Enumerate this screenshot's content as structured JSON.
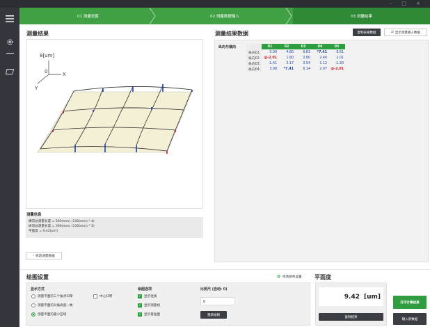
{
  "window": {
    "controls": "– □ ×"
  },
  "steps": [
    {
      "label": "01 测量设置"
    },
    {
      "label": "02 测量数据输入"
    },
    {
      "label": "03 测量结果"
    }
  ],
  "result_panel": {
    "title": "测量结果",
    "axis": {
      "z_label": "8[um]",
      "origin": "0",
      "x": "X",
      "y": "Y"
    },
    "info_title": "测量信息",
    "info_lines": [
      "横向总测量长度 = 560(mm) (140(mm) * 4)",
      "纵向总测量长度 = 390(mm) (130(mm) * 3)",
      "平面度 = 9.42[um]"
    ],
    "edit_button": "修改测量数据"
  },
  "data_panel": {
    "title": "测量结果数据",
    "copy_table_button": "复制表格数据",
    "toggle_button": "显示测量输入数据",
    "table_label": "纵向与横向",
    "columns": [
      "01",
      "02",
      "03",
      "04",
      "05"
    ],
    "rows": [
      {
        "label": "纵向01",
        "values": [
          "0.00",
          "4.80",
          "6.81",
          "*7.41",
          "6.61"
        ]
      },
      {
        "label": "纵向02",
        "values": [
          "@-2.01",
          "1.80",
          "2.80",
          "2.40",
          "2.01"
        ]
      },
      {
        "label": "纵向03",
        "values": [
          "-1.41",
          "3.17",
          "3.54",
          "1.12",
          "-1.30"
        ]
      },
      {
        "label": "纵向04",
        "values": [
          "3.08",
          "*7.41",
          "6.14",
          "2.07",
          "@-2.01"
        ]
      }
    ]
  },
  "draw_settings": {
    "title": "绘图设置",
    "color_link": "修改颜色设置",
    "display_mode_title": "显示方式",
    "display_modes": [
      {
        "label": "测量平面的三个角点归零",
        "selected": false
      },
      {
        "label": "测量平面的对角高度一致",
        "selected": false
      },
      {
        "label": "测量平面的最小区域",
        "selected": true
      }
    ],
    "center_zero": "中心归零",
    "draw_options_title": "绘图选项",
    "draw_options": [
      {
        "label": "显示连线",
        "checked": true
      },
      {
        "label": "显示测量线",
        "checked": true
      },
      {
        "label": "显示基准面",
        "checked": true
      }
    ],
    "scale_title": "比例尺 (自动: 0)",
    "scale_value": "0",
    "redraw_button": "重新绘制"
  },
  "flatness": {
    "title": "平面度",
    "value": "9.42",
    "unit": "[um]",
    "copy_button": "复制结果",
    "print_button": "打印计算结果",
    "new_data_button": "输入新数据"
  },
  "colors": {
    "accent": "#2e9e3e",
    "sidebar": "#33373c",
    "max": "#1a3fb0",
    "min": "#d0161f"
  }
}
